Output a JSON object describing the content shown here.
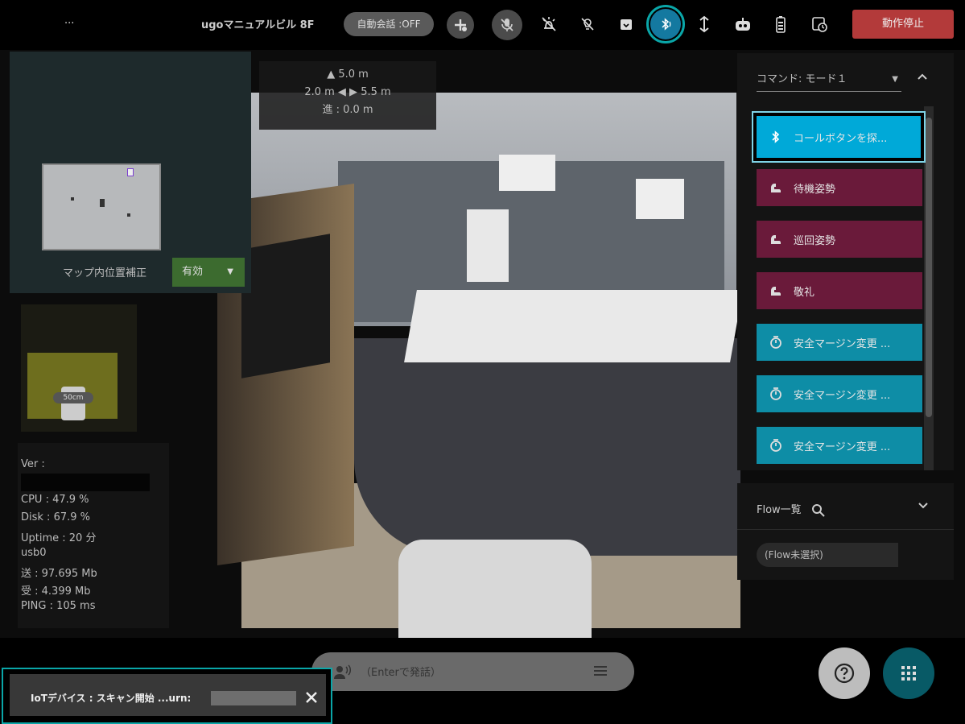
{
  "topbar": {
    "menu_label": "...",
    "robot_name": "ugoマニュアルビル 8F",
    "auto_talk": "自動会話 :OFF",
    "stop_button": "動作停止"
  },
  "distance": {
    "forward": "▲ 5.0 m",
    "sides": "2.0 m ◀ ▶ 5.5 m",
    "progress": "進 : 0.0 m"
  },
  "minimap": {
    "correction_label": "マップ内位置補正",
    "correction_value": "有効"
  },
  "proximity": {
    "scale_label": "50cm"
  },
  "stats": {
    "ver": "Ver :",
    "cpu": "CPU : 47.9 %",
    "disk": "Disk : 67.9 %",
    "uptime": "Uptime : 20 分",
    "iface": "usb0",
    "sent": "送 : 97.695 Mb",
    "recv": "受 : 4.399 Mb",
    "ping": "PING : 105 ms"
  },
  "commands": {
    "mode": "コマンド: モード１",
    "items": [
      {
        "label": "コールボタンを探...",
        "color": "#00a9d8"
      },
      {
        "label": "待機姿勢",
        "color": "#6a1a3a"
      },
      {
        "label": "巡回姿勢",
        "color": "#6a1a3a"
      },
      {
        "label": "敬礼",
        "color": "#6a1a3a"
      },
      {
        "label": "安全マージン変更 ...",
        "color": "#0e8da6"
      },
      {
        "label": "安全マージン変更 ...",
        "color": "#0e8da6"
      },
      {
        "label": "安全マージン変更 ...",
        "color": "#0e8da6"
      }
    ]
  },
  "flow": {
    "title": "Flow一覧",
    "selected": "(Flow未選択)"
  },
  "speak": {
    "placeholder": "（Enterで発話）"
  },
  "toast": {
    "message": "IoTデバイス : スキャン開始 ...urn:"
  },
  "icons": {
    "bluetooth": "bluetooth-icon",
    "help": "help-icon",
    "grid": "grid-icon",
    "close": "close-icon"
  }
}
